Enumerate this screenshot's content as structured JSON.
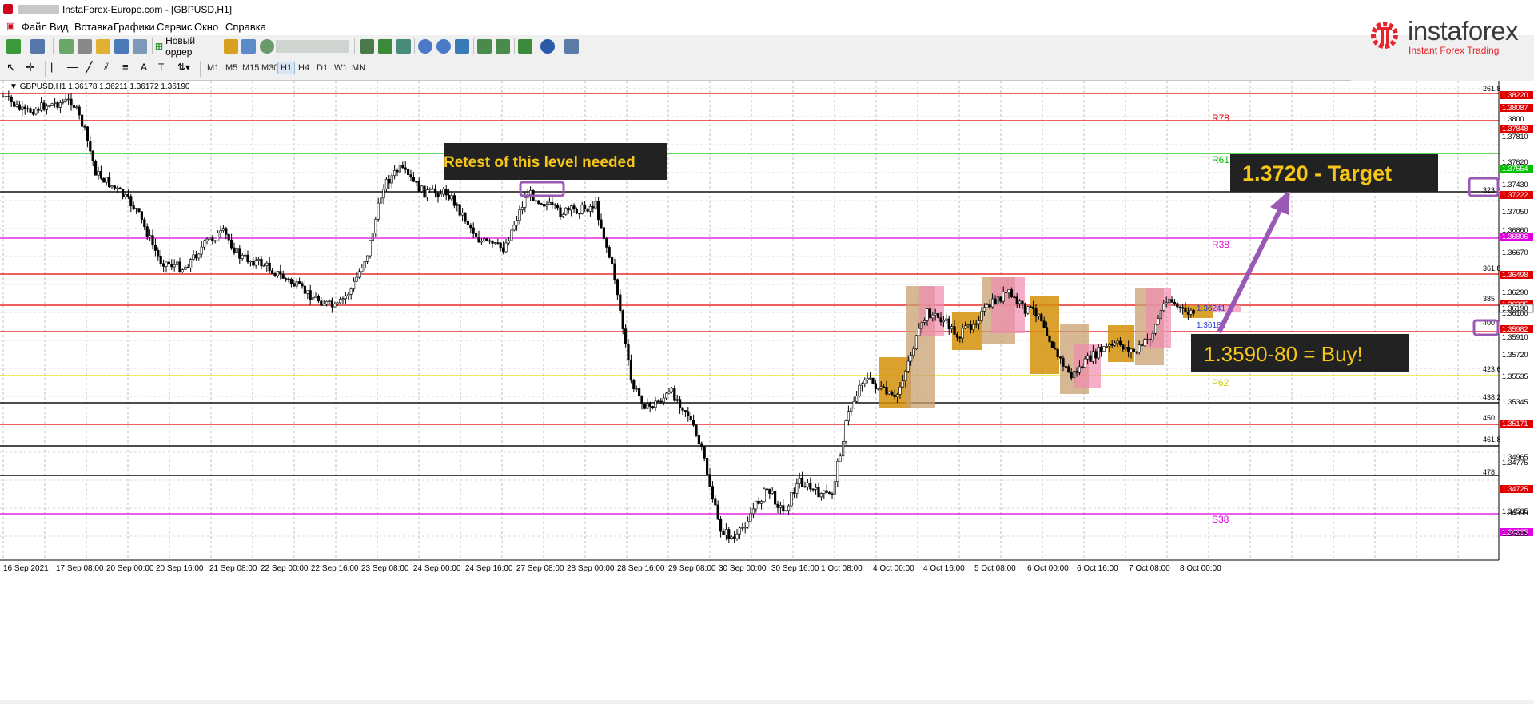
{
  "window": {
    "title": "InstaForex-Europe.com - [GBPUSD,H1]"
  },
  "menu": {
    "items": [
      "Файл",
      "Вид",
      "Вставка",
      "Графики",
      "Сервис",
      "Окно",
      "Справка"
    ]
  },
  "toolbar": {
    "new_order_label": "Новый ордер",
    "timeframes": [
      "M1",
      "M5",
      "M15",
      "M30",
      "H1",
      "H4",
      "D1",
      "W1",
      "MN"
    ],
    "active_timeframe": "H1"
  },
  "logo": {
    "brand": "instaforex",
    "tagline": "Instant Forex Trading",
    "color": "#e8232a"
  },
  "chart": {
    "symbol_line": "GBPUSD,H1  1.36178 1.36211 1.36172 1.36190",
    "annotations": {
      "retest": "Retest of this level needed",
      "target": "1.3720 - Target",
      "buy": "1.3590-80 = Buy!"
    },
    "price_axis": [
      "261.8",
      "1.38220",
      "1.38087",
      "1.3800",
      "1.37848",
      "1.37810",
      "1.37620",
      "1.37554",
      "1.37430",
      "323.6",
      "1.37222",
      "1.37050",
      "1.36860",
      "1.36806",
      "1.36670",
      "361.8",
      "1.36498",
      "1.36290",
      "385",
      "1.36225",
      "1.36190",
      "1.36100",
      "400",
      "1.35982",
      "1.35910",
      "1.35720",
      "423.6",
      "1.35535",
      "438.2",
      "1.35345",
      "450",
      "1.35171",
      "461.8",
      "1.34965",
      "1.34775",
      "478",
      "1.34725",
      "1.34585",
      "1.34395",
      "1.34385",
      "1.34205"
    ],
    "time_axis": [
      "16 Sep 2021",
      "17 Sep 08:00",
      "20 Sep 00:00",
      "20 Sep 16:00",
      "21 Sep 08:00",
      "22 Sep 00:00",
      "22 Sep 16:00",
      "23 Sep 08:00",
      "24 Sep 00:00",
      "24 Sep 16:00",
      "27 Sep 08:00",
      "28 Sep 00:00",
      "28 Sep 16:00",
      "29 Sep 08:00",
      "30 Sep 00:00",
      "30 Sep 16:00",
      "1 Oct 08:00",
      "4 Oct 00:00",
      "4 Oct 16:00",
      "5 Oct 08:00",
      "6 Oct 00:00",
      "6 Oct 16:00",
      "7 Oct 08:00",
      "8 Oct 00:00"
    ],
    "level_labels": [
      "R78",
      "R61",
      "R38",
      "S38",
      "P62"
    ],
    "inline_prices": [
      "1.36241",
      "1.36181"
    ],
    "colors": {
      "resistance": "#e00000",
      "green_level": "#00c000",
      "magenta_level": "#e000e0",
      "yellow_level": "#e0e000",
      "annotation_bg": "#222222",
      "annotation_text": "#f5c518",
      "arrow": "#9b59b6",
      "box_orange": "#d4900a",
      "box_pink": "#f08cb0",
      "box_tan": "#c9a070"
    }
  }
}
